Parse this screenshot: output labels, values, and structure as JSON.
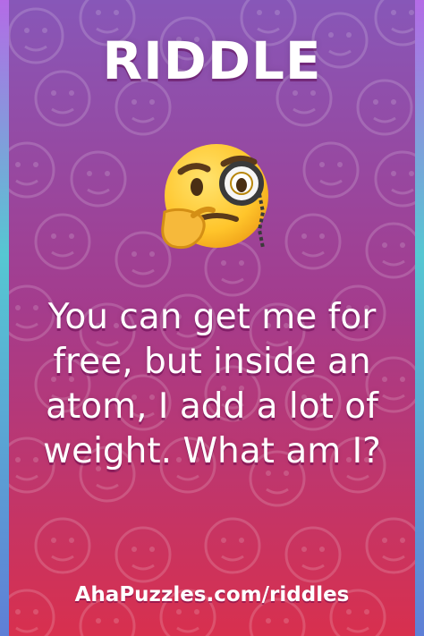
{
  "header": {
    "title": "RIDDLE"
  },
  "icon": {
    "name": "thinking-monocle-face-icon"
  },
  "riddle": {
    "question": "You can get me for free, but inside an atom, I add a lot of weight. What am I?"
  },
  "footer": {
    "site": "AhaPuzzles.com/riddles"
  },
  "colors": {
    "top": "#8757b8",
    "middle": "#a43c8d",
    "bottom": "#d8304e",
    "accent": "#56c7d2",
    "text": "#ffffff"
  }
}
